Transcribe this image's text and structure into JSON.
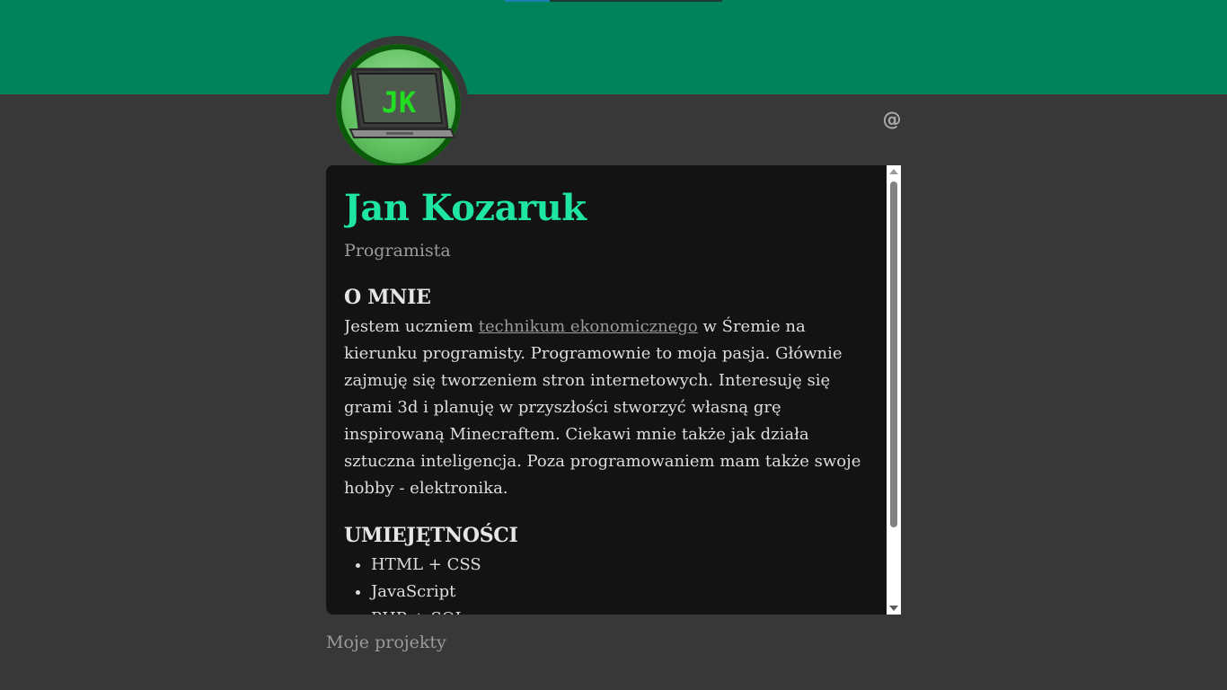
{
  "profile": {
    "initials": "JK",
    "name": "Jan Kozaruk",
    "role": "Programista"
  },
  "contact_icon": "at-icon",
  "about": {
    "heading": "O MNIE",
    "text_before_link": "Jestem uczniem ",
    "link_text": "technikum ekonomicznego",
    "text_after_link": " w Śremie na kierunku programisty. Programownie to moja pasja. Głównie zajmuję się tworzeniem stron internetowych. Interesuję się grami 3d i planuję w przyszłości stworzyć własną grę inspirowaną Minecraftem. Ciekawi mnie także jak działa sztuczna inteligencja. Poza programowaniem mam także swoje hobby - elektronika."
  },
  "skills": {
    "heading": "UMIEJĘTNOŚCI",
    "items": [
      "HTML + CSS",
      "JavaScript",
      "PHP + SQL"
    ]
  },
  "footer": {
    "projects_link": "Moje projekty"
  },
  "colors": {
    "banner": "#00825a",
    "name_accent": "#1ee6a0",
    "background": "#383838",
    "card": "#131313"
  }
}
